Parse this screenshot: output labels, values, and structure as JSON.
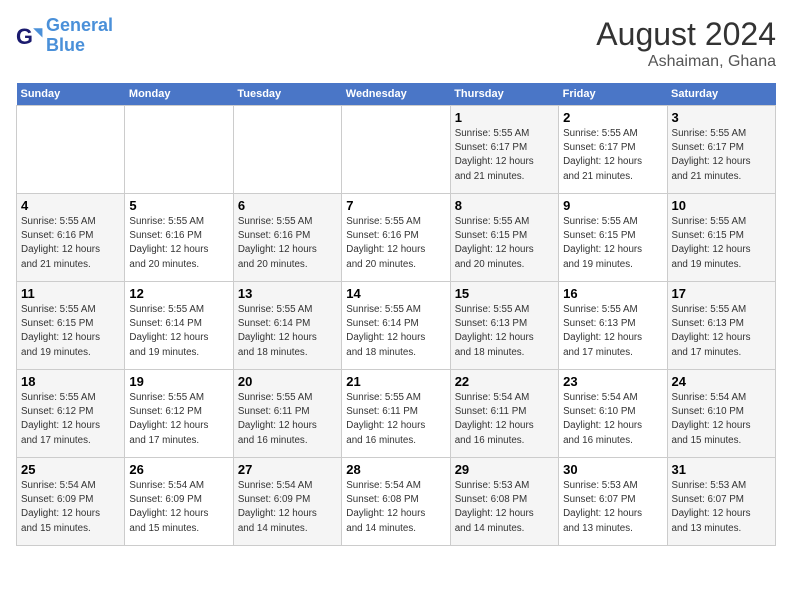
{
  "header": {
    "logo_line1": "General",
    "logo_line2": "Blue",
    "month_title": "August 2024",
    "location": "Ashaiman, Ghana"
  },
  "weekdays": [
    "Sunday",
    "Monday",
    "Tuesday",
    "Wednesday",
    "Thursday",
    "Friday",
    "Saturday"
  ],
  "weeks": [
    [
      {
        "day": "",
        "info": ""
      },
      {
        "day": "",
        "info": ""
      },
      {
        "day": "",
        "info": ""
      },
      {
        "day": "",
        "info": ""
      },
      {
        "day": "1",
        "info": "Sunrise: 5:55 AM\nSunset: 6:17 PM\nDaylight: 12 hours\nand 21 minutes."
      },
      {
        "day": "2",
        "info": "Sunrise: 5:55 AM\nSunset: 6:17 PM\nDaylight: 12 hours\nand 21 minutes."
      },
      {
        "day": "3",
        "info": "Sunrise: 5:55 AM\nSunset: 6:17 PM\nDaylight: 12 hours\nand 21 minutes."
      }
    ],
    [
      {
        "day": "4",
        "info": "Sunrise: 5:55 AM\nSunset: 6:16 PM\nDaylight: 12 hours\nand 21 minutes."
      },
      {
        "day": "5",
        "info": "Sunrise: 5:55 AM\nSunset: 6:16 PM\nDaylight: 12 hours\nand 20 minutes."
      },
      {
        "day": "6",
        "info": "Sunrise: 5:55 AM\nSunset: 6:16 PM\nDaylight: 12 hours\nand 20 minutes."
      },
      {
        "day": "7",
        "info": "Sunrise: 5:55 AM\nSunset: 6:16 PM\nDaylight: 12 hours\nand 20 minutes."
      },
      {
        "day": "8",
        "info": "Sunrise: 5:55 AM\nSunset: 6:15 PM\nDaylight: 12 hours\nand 20 minutes."
      },
      {
        "day": "9",
        "info": "Sunrise: 5:55 AM\nSunset: 6:15 PM\nDaylight: 12 hours\nand 19 minutes."
      },
      {
        "day": "10",
        "info": "Sunrise: 5:55 AM\nSunset: 6:15 PM\nDaylight: 12 hours\nand 19 minutes."
      }
    ],
    [
      {
        "day": "11",
        "info": "Sunrise: 5:55 AM\nSunset: 6:15 PM\nDaylight: 12 hours\nand 19 minutes."
      },
      {
        "day": "12",
        "info": "Sunrise: 5:55 AM\nSunset: 6:14 PM\nDaylight: 12 hours\nand 19 minutes."
      },
      {
        "day": "13",
        "info": "Sunrise: 5:55 AM\nSunset: 6:14 PM\nDaylight: 12 hours\nand 18 minutes."
      },
      {
        "day": "14",
        "info": "Sunrise: 5:55 AM\nSunset: 6:14 PM\nDaylight: 12 hours\nand 18 minutes."
      },
      {
        "day": "15",
        "info": "Sunrise: 5:55 AM\nSunset: 6:13 PM\nDaylight: 12 hours\nand 18 minutes."
      },
      {
        "day": "16",
        "info": "Sunrise: 5:55 AM\nSunset: 6:13 PM\nDaylight: 12 hours\nand 17 minutes."
      },
      {
        "day": "17",
        "info": "Sunrise: 5:55 AM\nSunset: 6:13 PM\nDaylight: 12 hours\nand 17 minutes."
      }
    ],
    [
      {
        "day": "18",
        "info": "Sunrise: 5:55 AM\nSunset: 6:12 PM\nDaylight: 12 hours\nand 17 minutes."
      },
      {
        "day": "19",
        "info": "Sunrise: 5:55 AM\nSunset: 6:12 PM\nDaylight: 12 hours\nand 17 minutes."
      },
      {
        "day": "20",
        "info": "Sunrise: 5:55 AM\nSunset: 6:11 PM\nDaylight: 12 hours\nand 16 minutes."
      },
      {
        "day": "21",
        "info": "Sunrise: 5:55 AM\nSunset: 6:11 PM\nDaylight: 12 hours\nand 16 minutes."
      },
      {
        "day": "22",
        "info": "Sunrise: 5:54 AM\nSunset: 6:11 PM\nDaylight: 12 hours\nand 16 minutes."
      },
      {
        "day": "23",
        "info": "Sunrise: 5:54 AM\nSunset: 6:10 PM\nDaylight: 12 hours\nand 16 minutes."
      },
      {
        "day": "24",
        "info": "Sunrise: 5:54 AM\nSunset: 6:10 PM\nDaylight: 12 hours\nand 15 minutes."
      }
    ],
    [
      {
        "day": "25",
        "info": "Sunrise: 5:54 AM\nSunset: 6:09 PM\nDaylight: 12 hours\nand 15 minutes."
      },
      {
        "day": "26",
        "info": "Sunrise: 5:54 AM\nSunset: 6:09 PM\nDaylight: 12 hours\nand 15 minutes."
      },
      {
        "day": "27",
        "info": "Sunrise: 5:54 AM\nSunset: 6:09 PM\nDaylight: 12 hours\nand 14 minutes."
      },
      {
        "day": "28",
        "info": "Sunrise: 5:54 AM\nSunset: 6:08 PM\nDaylight: 12 hours\nand 14 minutes."
      },
      {
        "day": "29",
        "info": "Sunrise: 5:53 AM\nSunset: 6:08 PM\nDaylight: 12 hours\nand 14 minutes."
      },
      {
        "day": "30",
        "info": "Sunrise: 5:53 AM\nSunset: 6:07 PM\nDaylight: 12 hours\nand 13 minutes."
      },
      {
        "day": "31",
        "info": "Sunrise: 5:53 AM\nSunset: 6:07 PM\nDaylight: 12 hours\nand 13 minutes."
      }
    ]
  ]
}
